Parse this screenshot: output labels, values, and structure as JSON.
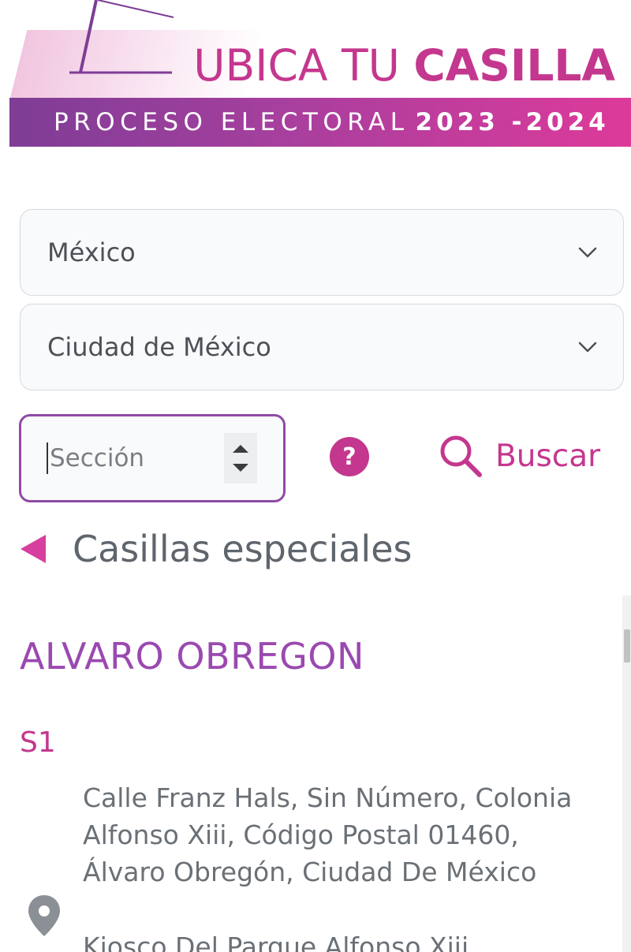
{
  "banner": {
    "title_light": "UBICA TU ",
    "title_bold": "CASILLA",
    "subtitle_light": "PROCESO ELECTORAL",
    "subtitle_bold": "2023 -2024",
    "colors": {
      "pink": "#c4378e",
      "purple": "#7e3d96"
    }
  },
  "filters": {
    "country": {
      "selected": "México",
      "icon": "chevron-down-icon"
    },
    "state": {
      "selected": "Ciudad de México",
      "icon": "chevron-down-icon"
    }
  },
  "search": {
    "seccion_placeholder": "Sección",
    "help_icon": "question-circle-icon",
    "button_label": "Buscar",
    "button_icon": "search-icon"
  },
  "especiales": {
    "label": "Casillas especiales",
    "icon": "triangle-left-icon"
  },
  "results": {
    "district": "ALVARO OBREGON",
    "casilla_id": "S1",
    "address": "Calle Franz Hals, Sin Número, Colonia Alfonso Xiii, Código Postal 01460, Álvaro Obregón, Ciudad De México",
    "address_next": "Kiosco Del Parque Alfonso Xiii",
    "pin_icon": "map-pin-icon"
  }
}
